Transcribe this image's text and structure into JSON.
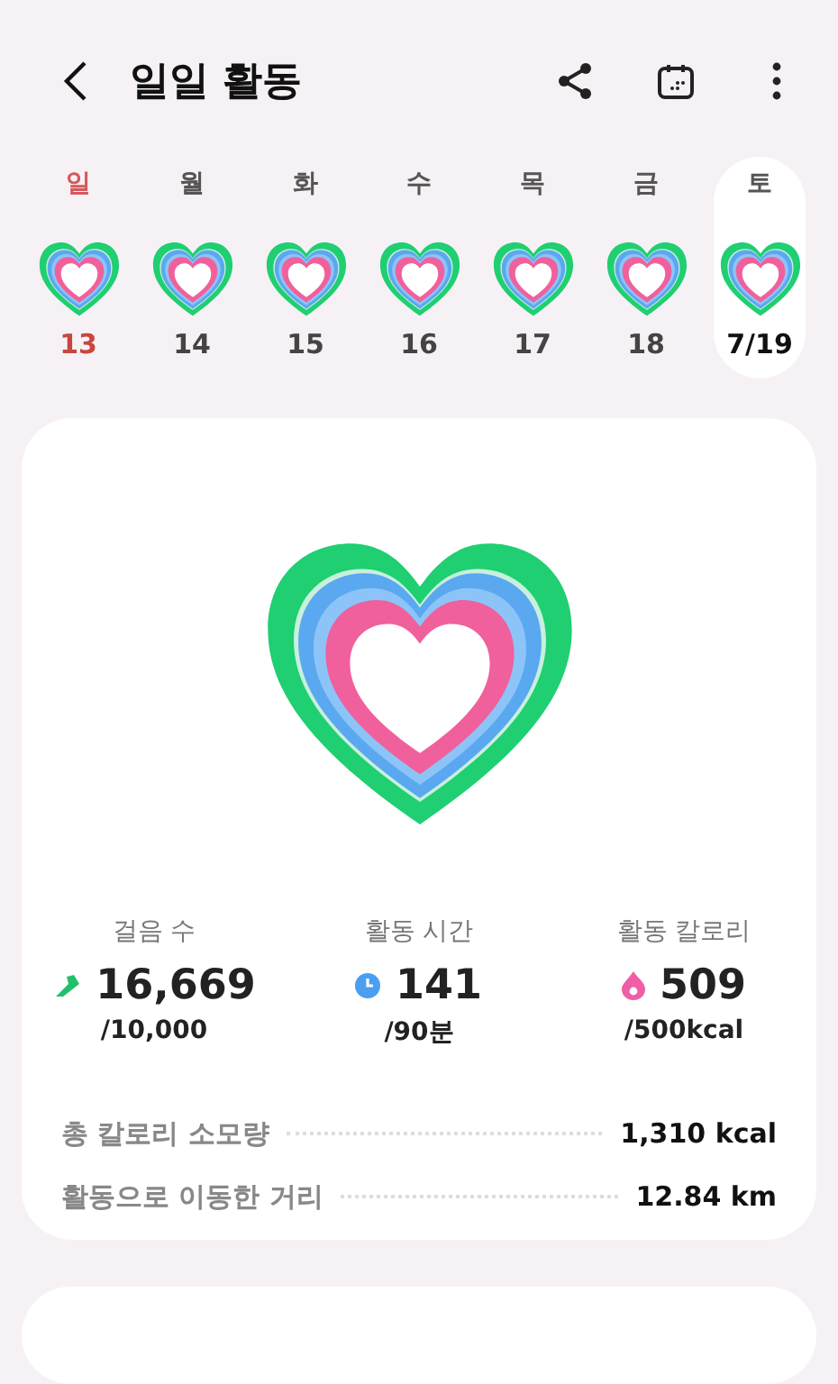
{
  "header": {
    "title": "일일 활동"
  },
  "week": [
    {
      "day": "일",
      "date": "13",
      "holiday": true,
      "selected": false
    },
    {
      "day": "월",
      "date": "14",
      "holiday": false,
      "selected": false
    },
    {
      "day": "화",
      "date": "15",
      "holiday": false,
      "selected": false
    },
    {
      "day": "수",
      "date": "16",
      "holiday": false,
      "selected": false
    },
    {
      "day": "목",
      "date": "17",
      "holiday": false,
      "selected": false
    },
    {
      "day": "금",
      "date": "18",
      "holiday": false,
      "selected": false
    },
    {
      "day": "토",
      "date": "7/19",
      "holiday": false,
      "selected": true
    }
  ],
  "stats": [
    {
      "kind": "steps",
      "label": "걸음 수",
      "value": "16,669",
      "goal": "/10,000"
    },
    {
      "kind": "time",
      "label": "활동 시간",
      "value": "141",
      "goal": "/90분"
    },
    {
      "kind": "calories",
      "label": "활동 칼로리",
      "value": "509",
      "goal": "/500kcal"
    }
  ],
  "details": [
    {
      "label": "총 칼로리 소모량",
      "value": "1,310",
      "unit": "kcal"
    },
    {
      "label": "활동으로 이동한 거리",
      "value": "12.84",
      "unit": "km"
    }
  ]
}
